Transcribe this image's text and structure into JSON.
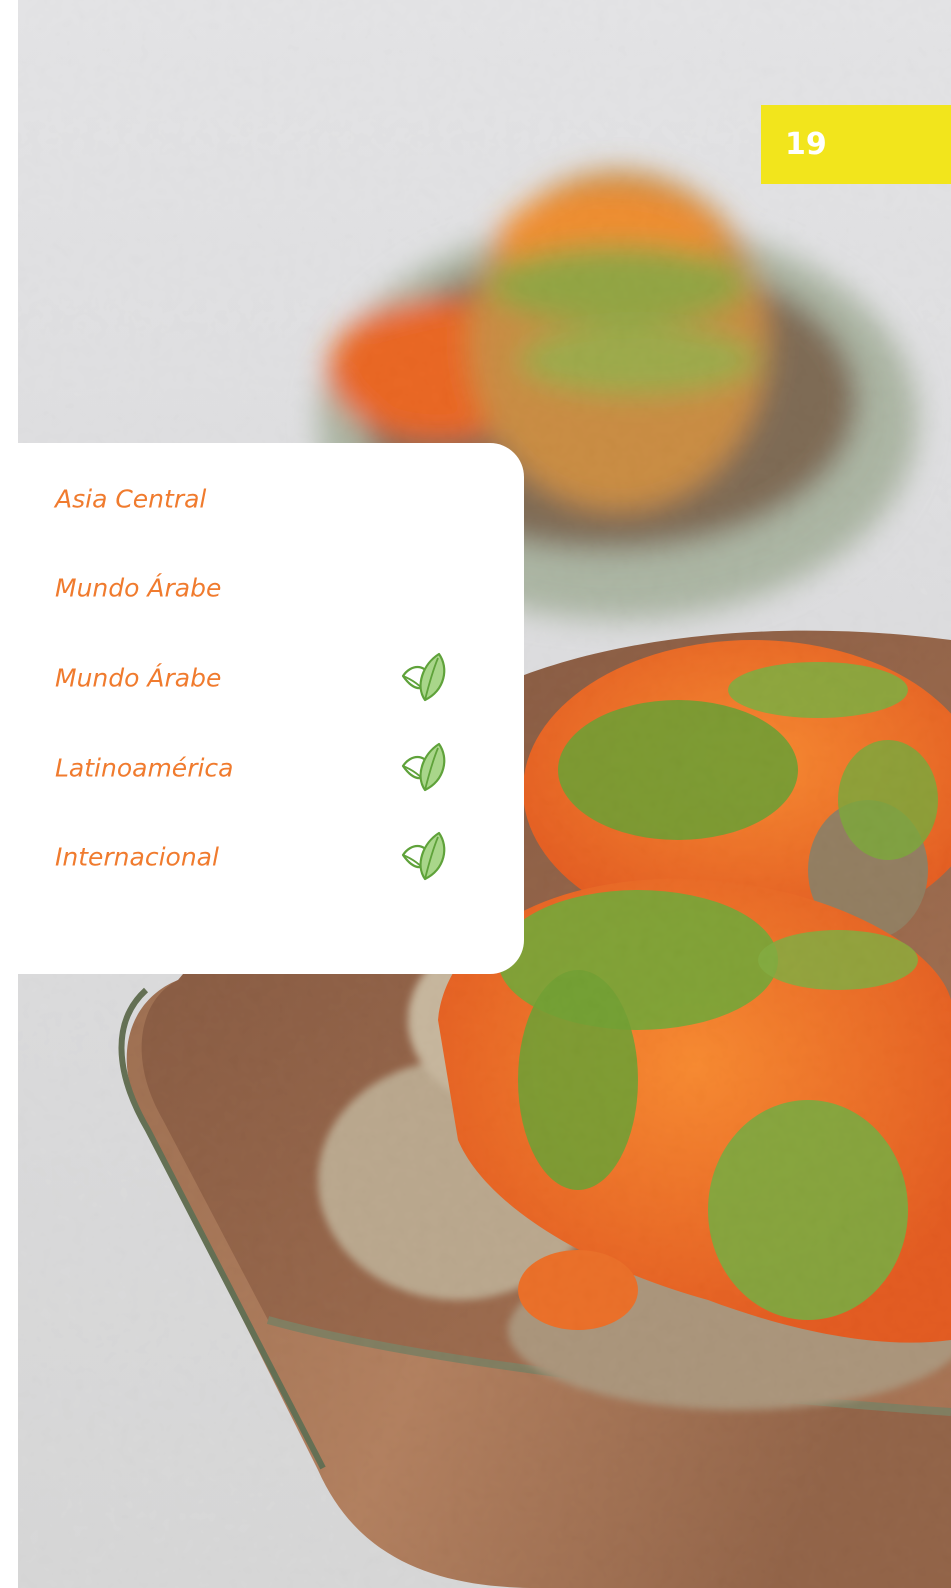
{
  "page": {
    "number": "19"
  },
  "menu": {
    "items": [
      {
        "label": "Asia Central",
        "vegetarian": false
      },
      {
        "label": "Mundo Árabe",
        "vegetarian": false
      },
      {
        "label": "Mundo Árabe",
        "vegetarian": true,
        "icon": "leaf-icon"
      },
      {
        "label": "Latinoamérica",
        "vegetarian": true,
        "icon": "leaf-icon"
      },
      {
        "label": "Internacional",
        "vegetarian": true,
        "icon": "leaf-icon"
      }
    ]
  },
  "colors": {
    "badge": "#f2e51c",
    "item_text": "#f07b2e",
    "leaf_icon": "#5fa23a",
    "card": "#ffffff"
  }
}
